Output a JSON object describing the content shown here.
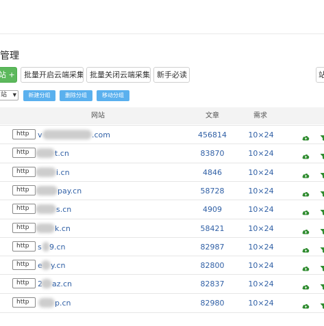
{
  "page": {
    "title": "管理"
  },
  "toolbar": {
    "add_site_label": "站 +",
    "batch_enable_label": "批量开启云端采集",
    "batch_disable_label": "批量关闭云端采集",
    "guide_label": "新手必读",
    "right_button_label": "站"
  },
  "filter": {
    "group_select_value": "站",
    "new_group_label": "新建分组",
    "delete_group_label": "删除分组",
    "move_group_label": "移动分组"
  },
  "table": {
    "columns": {
      "site": "网站",
      "articles": "文章",
      "demand": "需求"
    },
    "rows": [
      {
        "protocol": "http",
        "site_prefix": "v",
        "site_suffix": ".com",
        "articles": "456814",
        "demand": "10×24"
      },
      {
        "protocol": "http",
        "site_prefix": "",
        "site_suffix": "t.cn",
        "articles": "83870",
        "demand": "10×24"
      },
      {
        "protocol": "http",
        "site_prefix": "",
        "site_suffix": "i.cn",
        "articles": "4846",
        "demand": "10×24"
      },
      {
        "protocol": "http",
        "site_prefix": "",
        "site_suffix": "pay.cn",
        "articles": "58728",
        "demand": "10×24"
      },
      {
        "protocol": "http",
        "site_prefix": "",
        "site_suffix": "s.cn",
        "articles": "4909",
        "demand": "10×24"
      },
      {
        "protocol": "http",
        "site_prefix": "",
        "site_suffix": "k.cn",
        "articles": "58421",
        "demand": "10×24"
      },
      {
        "protocol": "http",
        "site_prefix": "s",
        "site_suffix": "9.cn",
        "articles": "82987",
        "demand": "10×24"
      },
      {
        "protocol": "http",
        "site_prefix": "e",
        "site_suffix": "y.cn",
        "articles": "82800",
        "demand": "10×24"
      },
      {
        "protocol": "http",
        "site_prefix": "2",
        "site_suffix": "az.cn",
        "articles": "82837",
        "demand": "10×24"
      },
      {
        "protocol": "http",
        "site_prefix": "",
        "site_suffix": "p.cn",
        "articles": "82980",
        "demand": "10×24"
      }
    ]
  },
  "icons": {
    "row_action_1": "cloud-upload-icon",
    "row_action_2": "filter-icon"
  },
  "colors": {
    "green": "#5cb85c",
    "blue_button": "#5ab0ee",
    "link": "#2f5fa5",
    "action_green": "#2e8b2e"
  }
}
